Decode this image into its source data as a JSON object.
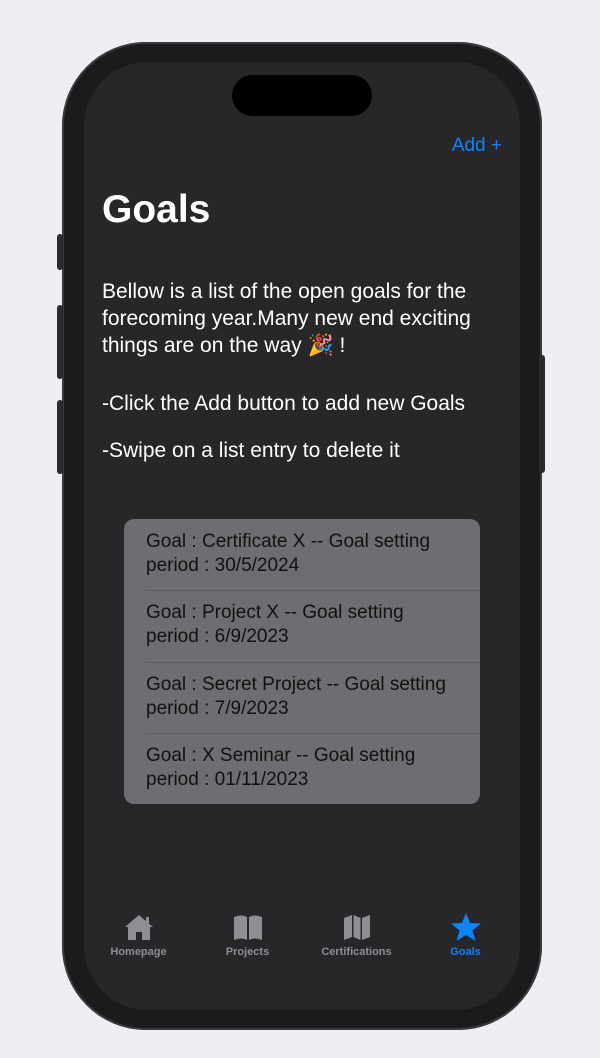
{
  "header": {
    "add_label": "Add +"
  },
  "page": {
    "title": "Goals",
    "intro": "Bellow is a list of the open goals for the forecoming year.Many new end exciting things are on the way 🎉 !",
    "hint_add": "-Click the Add button to add new Goals",
    "hint_swipe": "-Swipe on a list entry to delete it"
  },
  "goals": [
    {
      "line1": "Goal : Certificate X -- Goal setting",
      "line2": "period  : 30/5/2024"
    },
    {
      "line1": "Goal : Project X -- Goal setting",
      "line2": "period  : 6/9/2023"
    },
    {
      "line1": "Goal : Secret Project -- Goal setting",
      "line2": "period  : 7/9/2023"
    },
    {
      "line1": "Goal : X Seminar -- Goal setting",
      "line2": "period  : 01/11/2023"
    }
  ],
  "tabs": [
    {
      "label": "Homepage",
      "icon": "house-icon"
    },
    {
      "label": "Projects",
      "icon": "book-icon"
    },
    {
      "label": "Certifications",
      "icon": "map-icon"
    },
    {
      "label": "Goals",
      "icon": "star-icon",
      "active": true
    }
  ],
  "colors": {
    "accent": "#0a84ff",
    "background": "#272629",
    "list_background": "#6e6d71",
    "inactive_tab": "#8e8e93"
  }
}
